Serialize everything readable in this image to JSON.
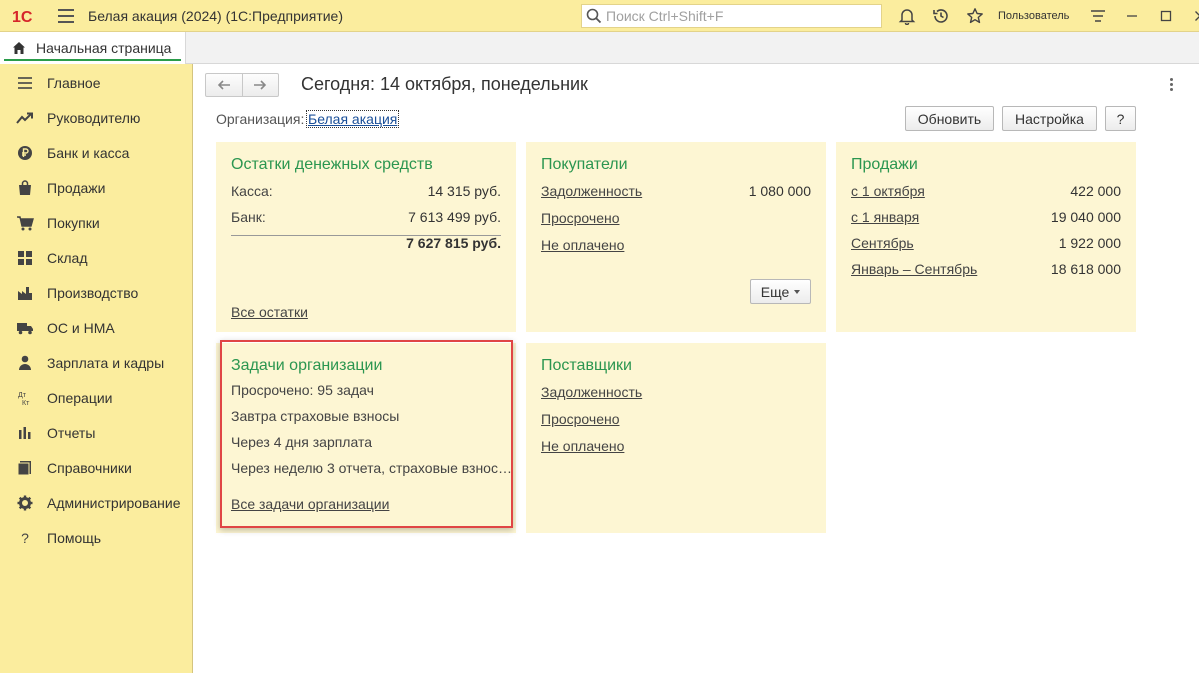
{
  "titlebar": {
    "logo_text": "1С",
    "title": "Белая акация (2024)  (1С:Предприятие)",
    "search_placeholder": "Поиск Ctrl+Shift+F",
    "user": "Пользователь"
  },
  "tabs": {
    "home": "Начальная страница"
  },
  "sidebar": {
    "items": [
      {
        "label": "Главное",
        "icon": "menu-lines-icon"
      },
      {
        "label": "Руководителю",
        "icon": "trend-up-icon"
      },
      {
        "label": "Банк и касса",
        "icon": "ruble-coin-icon"
      },
      {
        "label": "Продажи",
        "icon": "shopping-bag-icon"
      },
      {
        "label": "Покупки",
        "icon": "cart-icon"
      },
      {
        "label": "Склад",
        "icon": "warehouse-icon"
      },
      {
        "label": "Производство",
        "icon": "factory-icon"
      },
      {
        "label": "ОС и НМА",
        "icon": "truck-icon"
      },
      {
        "label": "Зарплата и кадры",
        "icon": "person-icon"
      },
      {
        "label": "Операции",
        "icon": "dt-kt-icon",
        "icon_text_top": "Дт",
        "icon_text_bottom": "Кт"
      },
      {
        "label": "Отчеты",
        "icon": "bar-chart-icon"
      },
      {
        "label": "Справочники",
        "icon": "books-icon"
      },
      {
        "label": "Администрирование",
        "icon": "gear-icon"
      },
      {
        "label": "Помощь",
        "icon": "question-icon",
        "icon_text": "?"
      }
    ]
  },
  "main": {
    "title": "Сегодня: 14 октября, понедельник",
    "org_label": "Организация:",
    "org_value": "Белая акация",
    "buttons": {
      "refresh": "Обновить",
      "settings": "Настройка",
      "help": "?"
    },
    "cash": {
      "title": "Остатки денежных средств",
      "rows": [
        {
          "label": "Касса:",
          "value": "14 315 руб."
        },
        {
          "label": "Банк:",
          "value": "7 613 499 руб."
        }
      ],
      "total": "7 627 815 руб.",
      "link": "Все остатки"
    },
    "buyers": {
      "title": "Покупатели",
      "rows": [
        {
          "label": "Задолженность",
          "value": "1 080 000"
        },
        {
          "label": "Просрочено",
          "value": ""
        },
        {
          "label": "Не оплачено",
          "value": ""
        }
      ],
      "more": "Еще"
    },
    "sales": {
      "title": "Продажи",
      "rows": [
        {
          "label": "с 1 октября",
          "value": "422 000"
        },
        {
          "label": "с 1 января",
          "value": "19 040 000"
        },
        {
          "label": "Сентябрь",
          "value": "1 922 000"
        },
        {
          "label": "Январь – Сентябрь",
          "value": "18 618 000"
        }
      ]
    },
    "tasks": {
      "title": "Задачи организации",
      "overdue": "Просрочено: 95 задач",
      "tomorrow": "Завтра страховые взносы",
      "in4days": "Через 4 дня зарплата",
      "inweek": "Через неделю 3 отчета, страховые взнос…",
      "link": "Все задачи организации"
    },
    "suppliers": {
      "title": "Поставщики",
      "rows": [
        {
          "label": "Задолженность"
        },
        {
          "label": "Просрочено"
        },
        {
          "label": "Не оплачено"
        }
      ]
    }
  },
  "colors": {
    "accent_green": "#2b9650",
    "sidebar_bg": "#fbed9e",
    "card_bg": "#fdf6d3",
    "link_blue": "#1a4f99",
    "highlight_red": "#e04545",
    "overdue_red": "#c0262a",
    "warning_orange": "#c77a12"
  }
}
